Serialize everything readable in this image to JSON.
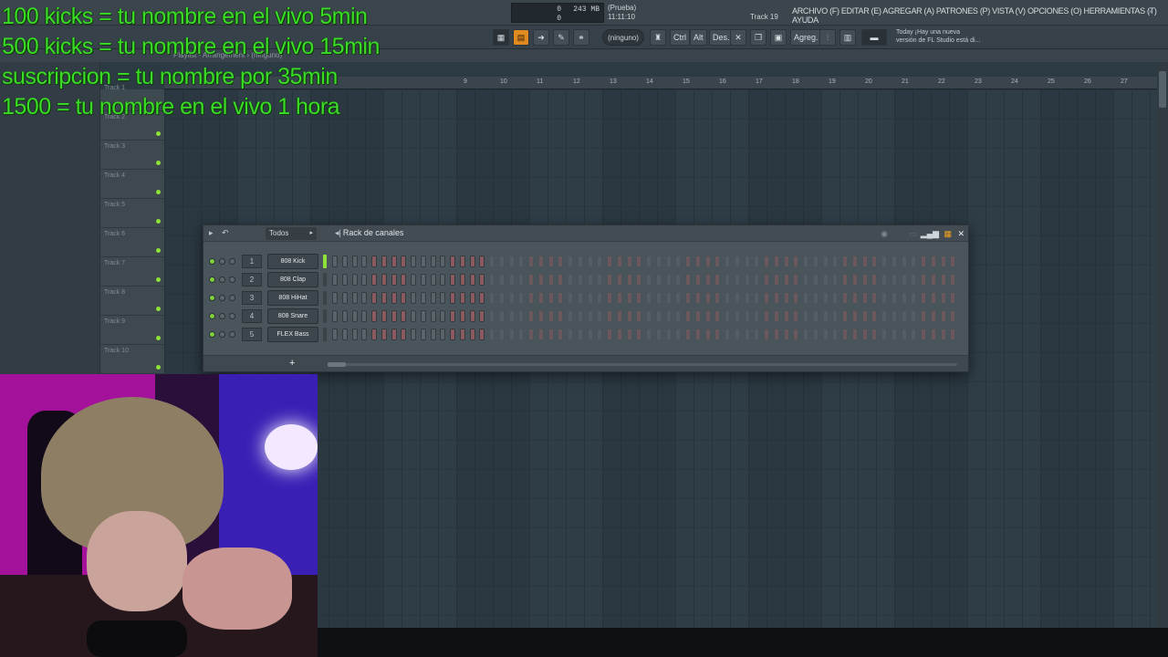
{
  "overlay": {
    "lines": [
      "100 kicks = tu nombre en el vivo 5min",
      "500 kicks = tu nombre en el vivo 15min",
      "suscripcion = tu nombre por 35min",
      "1500 = tu nombre en el vivo 1 hora"
    ]
  },
  "topbar": {
    "monitor_top_left": "0",
    "monitor_top_right": "243 MB",
    "monitor_bottom": "0",
    "hint_line1": "(Prueba)",
    "hint_line2": "11:11:10",
    "track_label": "Track 19",
    "menu": "ARCHIVO (F) EDITAR (E) AGREGAR (A) PATRONES (P) VISTA (V) OPCIONES (O) HERRAMIENTAS (T) AYUDA",
    "window_buttons": "– ▫ ×"
  },
  "toolbar": {
    "pattern_selector": "(ninguno)",
    "ctrl": "Ctrl",
    "alt": "Alt",
    "des": "Des.",
    "agreg": "Agreg.",
    "news_line1": "Today  ¡Hay una nueva",
    "news_line2": "versión de FL Studio está di..."
  },
  "playlist": {
    "header": "Playlist - Arrangement › (ninguno)",
    "ruler": [
      "9",
      "10",
      "11",
      "12",
      "13",
      "14",
      "15",
      "16",
      "17",
      "18",
      "19",
      "20",
      "21",
      "22",
      "23",
      "24",
      "25",
      "26",
      "27"
    ],
    "tracks": [
      "Track 3",
      "Track 4",
      "Track 5",
      "Track 6",
      "Track 7",
      "Track 8",
      "Track 9",
      "Track 10"
    ],
    "top_tracks": [
      "Track 1",
      "Track 2"
    ]
  },
  "rack": {
    "title": "Rack de canales",
    "filter": "Todos",
    "add": "+",
    "channels": [
      {
        "num": "1",
        "name": "808 Kick",
        "selected": true
      },
      {
        "num": "2",
        "name": "808 Clap",
        "selected": false
      },
      {
        "num": "3",
        "name": "808 HiHat",
        "selected": false
      },
      {
        "num": "4",
        "name": "808 Snare",
        "selected": false
      },
      {
        "num": "5",
        "name": "FLEX Bass",
        "selected": false
      }
    ]
  },
  "colors": {
    "overlay_text": "#3bdc28",
    "accent_orange": "#f0a020",
    "led_green": "#8fe13a"
  }
}
